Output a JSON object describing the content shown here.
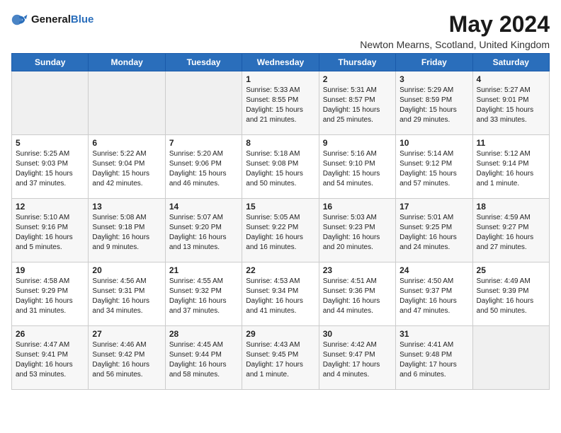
{
  "logo": {
    "general": "General",
    "blue": "Blue"
  },
  "title": "May 2024",
  "location": "Newton Mearns, Scotland, United Kingdom",
  "days_of_week": [
    "Sunday",
    "Monday",
    "Tuesday",
    "Wednesday",
    "Thursday",
    "Friday",
    "Saturday"
  ],
  "weeks": [
    [
      {
        "day": "",
        "content": ""
      },
      {
        "day": "",
        "content": ""
      },
      {
        "day": "",
        "content": ""
      },
      {
        "day": "1",
        "content": "Sunrise: 5:33 AM\nSunset: 8:55 PM\nDaylight: 15 hours\nand 21 minutes."
      },
      {
        "day": "2",
        "content": "Sunrise: 5:31 AM\nSunset: 8:57 PM\nDaylight: 15 hours\nand 25 minutes."
      },
      {
        "day": "3",
        "content": "Sunrise: 5:29 AM\nSunset: 8:59 PM\nDaylight: 15 hours\nand 29 minutes."
      },
      {
        "day": "4",
        "content": "Sunrise: 5:27 AM\nSunset: 9:01 PM\nDaylight: 15 hours\nand 33 minutes."
      }
    ],
    [
      {
        "day": "5",
        "content": "Sunrise: 5:25 AM\nSunset: 9:03 PM\nDaylight: 15 hours\nand 37 minutes."
      },
      {
        "day": "6",
        "content": "Sunrise: 5:22 AM\nSunset: 9:04 PM\nDaylight: 15 hours\nand 42 minutes."
      },
      {
        "day": "7",
        "content": "Sunrise: 5:20 AM\nSunset: 9:06 PM\nDaylight: 15 hours\nand 46 minutes."
      },
      {
        "day": "8",
        "content": "Sunrise: 5:18 AM\nSunset: 9:08 PM\nDaylight: 15 hours\nand 50 minutes."
      },
      {
        "day": "9",
        "content": "Sunrise: 5:16 AM\nSunset: 9:10 PM\nDaylight: 15 hours\nand 54 minutes."
      },
      {
        "day": "10",
        "content": "Sunrise: 5:14 AM\nSunset: 9:12 PM\nDaylight: 15 hours\nand 57 minutes."
      },
      {
        "day": "11",
        "content": "Sunrise: 5:12 AM\nSunset: 9:14 PM\nDaylight: 16 hours\nand 1 minute."
      }
    ],
    [
      {
        "day": "12",
        "content": "Sunrise: 5:10 AM\nSunset: 9:16 PM\nDaylight: 16 hours\nand 5 minutes."
      },
      {
        "day": "13",
        "content": "Sunrise: 5:08 AM\nSunset: 9:18 PM\nDaylight: 16 hours\nand 9 minutes."
      },
      {
        "day": "14",
        "content": "Sunrise: 5:07 AM\nSunset: 9:20 PM\nDaylight: 16 hours\nand 13 minutes."
      },
      {
        "day": "15",
        "content": "Sunrise: 5:05 AM\nSunset: 9:22 PM\nDaylight: 16 hours\nand 16 minutes."
      },
      {
        "day": "16",
        "content": "Sunrise: 5:03 AM\nSunset: 9:23 PM\nDaylight: 16 hours\nand 20 minutes."
      },
      {
        "day": "17",
        "content": "Sunrise: 5:01 AM\nSunset: 9:25 PM\nDaylight: 16 hours\nand 24 minutes."
      },
      {
        "day": "18",
        "content": "Sunrise: 4:59 AM\nSunset: 9:27 PM\nDaylight: 16 hours\nand 27 minutes."
      }
    ],
    [
      {
        "day": "19",
        "content": "Sunrise: 4:58 AM\nSunset: 9:29 PM\nDaylight: 16 hours\nand 31 minutes."
      },
      {
        "day": "20",
        "content": "Sunrise: 4:56 AM\nSunset: 9:31 PM\nDaylight: 16 hours\nand 34 minutes."
      },
      {
        "day": "21",
        "content": "Sunrise: 4:55 AM\nSunset: 9:32 PM\nDaylight: 16 hours\nand 37 minutes."
      },
      {
        "day": "22",
        "content": "Sunrise: 4:53 AM\nSunset: 9:34 PM\nDaylight: 16 hours\nand 41 minutes."
      },
      {
        "day": "23",
        "content": "Sunrise: 4:51 AM\nSunset: 9:36 PM\nDaylight: 16 hours\nand 44 minutes."
      },
      {
        "day": "24",
        "content": "Sunrise: 4:50 AM\nSunset: 9:37 PM\nDaylight: 16 hours\nand 47 minutes."
      },
      {
        "day": "25",
        "content": "Sunrise: 4:49 AM\nSunset: 9:39 PM\nDaylight: 16 hours\nand 50 minutes."
      }
    ],
    [
      {
        "day": "26",
        "content": "Sunrise: 4:47 AM\nSunset: 9:41 PM\nDaylight: 16 hours\nand 53 minutes."
      },
      {
        "day": "27",
        "content": "Sunrise: 4:46 AM\nSunset: 9:42 PM\nDaylight: 16 hours\nand 56 minutes."
      },
      {
        "day": "28",
        "content": "Sunrise: 4:45 AM\nSunset: 9:44 PM\nDaylight: 16 hours\nand 58 minutes."
      },
      {
        "day": "29",
        "content": "Sunrise: 4:43 AM\nSunset: 9:45 PM\nDaylight: 17 hours\nand 1 minute."
      },
      {
        "day": "30",
        "content": "Sunrise: 4:42 AM\nSunset: 9:47 PM\nDaylight: 17 hours\nand 4 minutes."
      },
      {
        "day": "31",
        "content": "Sunrise: 4:41 AM\nSunset: 9:48 PM\nDaylight: 17 hours\nand 6 minutes."
      },
      {
        "day": "",
        "content": ""
      }
    ]
  ]
}
